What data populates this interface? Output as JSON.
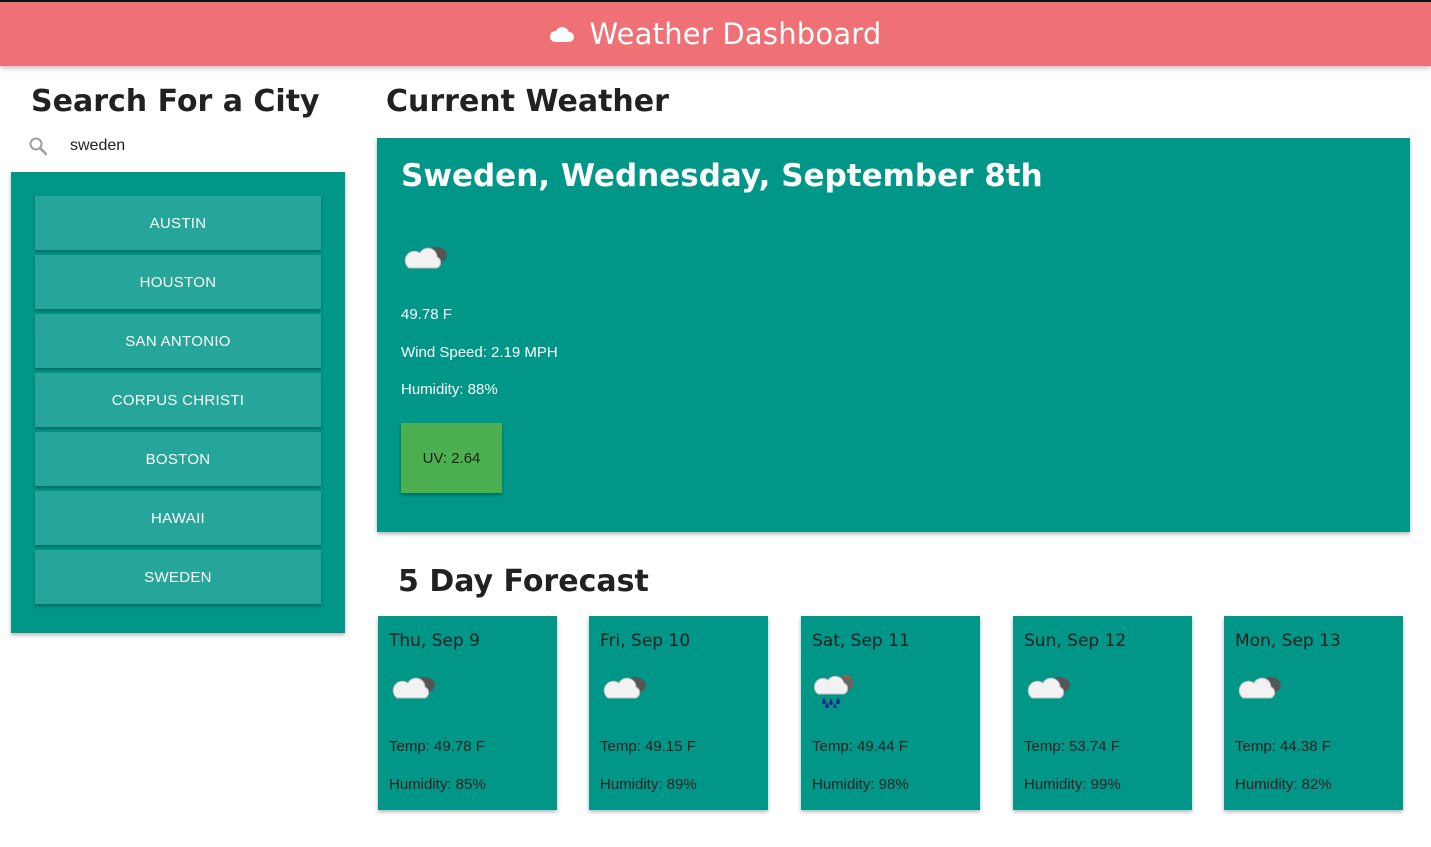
{
  "header": {
    "title": "Weather Dashboard",
    "icon": "cloud-icon"
  },
  "sidebar": {
    "heading": "Search For a City",
    "search_value": "sweden",
    "search_icon": "search-icon",
    "cities": [
      "AUSTIN",
      "HOUSTON",
      "SAN ANTONIO",
      "CORPUS CHRISTI",
      "BOSTON",
      "HAWAII",
      "SWEDEN"
    ]
  },
  "current": {
    "heading": "Current Weather",
    "title": "Sweden, Wednesday, September 8th",
    "icon": "cloudy-icon",
    "temp": "49.78 F",
    "wind": "Wind Speed: 2.19 MPH",
    "humidity": "Humidity: 88%",
    "uv": "UV: 2.64",
    "uv_color": "#4caf50"
  },
  "forecast": {
    "heading": "5 Day Forecast",
    "days": [
      {
        "date": "Thu, Sep 9",
        "icon": "cloudy-icon",
        "temp": "Temp: 49.78 F",
        "humidity": "Humidity: 85%"
      },
      {
        "date": "Fri, Sep 10",
        "icon": "cloudy-icon",
        "temp": "Temp: 49.15 F",
        "humidity": "Humidity: 89%"
      },
      {
        "date": "Sat, Sep 11",
        "icon": "rain-icon",
        "temp": "Temp: 49.44 F",
        "humidity": "Humidity: 98%"
      },
      {
        "date": "Sun, Sep 12",
        "icon": "cloudy-icon",
        "temp": "Temp: 53.74 F",
        "humidity": "Humidity: 99%"
      },
      {
        "date": "Mon, Sep 13",
        "icon": "cloudy-icon",
        "temp": "Temp: 44.38 F",
        "humidity": "Humidity: 82%"
      }
    ]
  },
  "colors": {
    "header": "#ef7176",
    "panel": "#009688",
    "button": "#26a69a",
    "uv": "#4caf50"
  }
}
